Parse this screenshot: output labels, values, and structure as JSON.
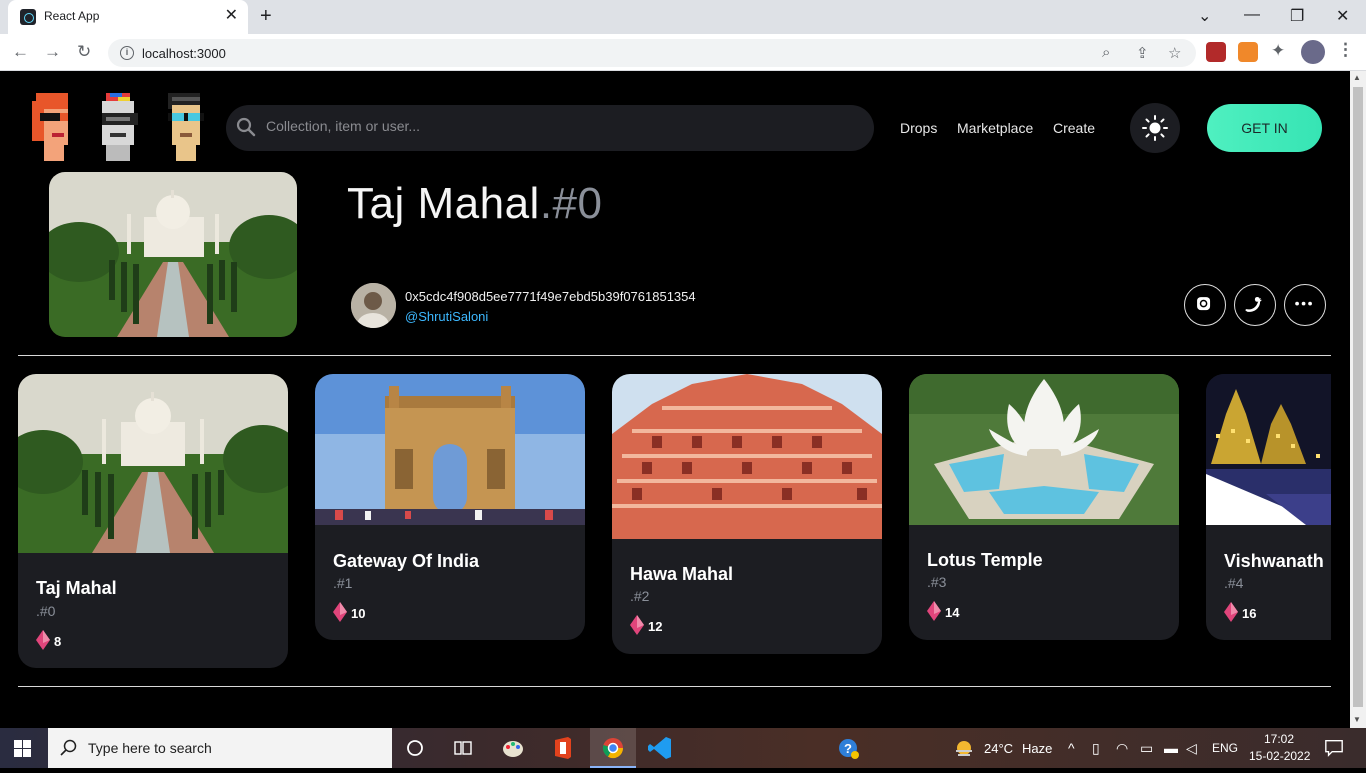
{
  "browser": {
    "tab_title": "React App",
    "tab_close": "✕",
    "new_tab": "+",
    "url": "localhost:3000",
    "window_controls": [
      "⌄",
      "—",
      "❐",
      "✕"
    ]
  },
  "header": {
    "search_placeholder": "Collection, item or user...",
    "nav": [
      "Drops",
      "Marketplace",
      "Create"
    ],
    "get_in_label": "GET IN"
  },
  "hero": {
    "title_name": "Taj Mahal",
    "title_id": ".#0",
    "owner_address": "0x5cdc4f908d5ee7771f49e7ebd5b39f0761851354",
    "owner_handle": "@ShrutiSaloni",
    "social_buttons": [
      "instagram-icon",
      "twitter-icon",
      "more-icon"
    ]
  },
  "cards": [
    {
      "name": "Taj Mahal",
      "id": ".#0",
      "price": "8"
    },
    {
      "name": "Gateway Of India",
      "id": ".#1",
      "price": "10"
    },
    {
      "name": "Hawa Mahal",
      "id": ".#2",
      "price": "12"
    },
    {
      "name": "Lotus Temple",
      "id": ".#3",
      "price": "14"
    },
    {
      "name": "Vishwanath",
      "id": ".#4",
      "price": "16"
    }
  ],
  "taskbar": {
    "search_placeholder": "Type here to search",
    "weather_temp": "24°C",
    "weather_desc": "Haze",
    "language": "ENG",
    "time": "17:02",
    "date": "15-02-2022"
  },
  "colors": {
    "accent": "#3ee8bb",
    "link": "#3db8ff",
    "card_bg": "#1c1d22",
    "eth": "#e0457b"
  }
}
